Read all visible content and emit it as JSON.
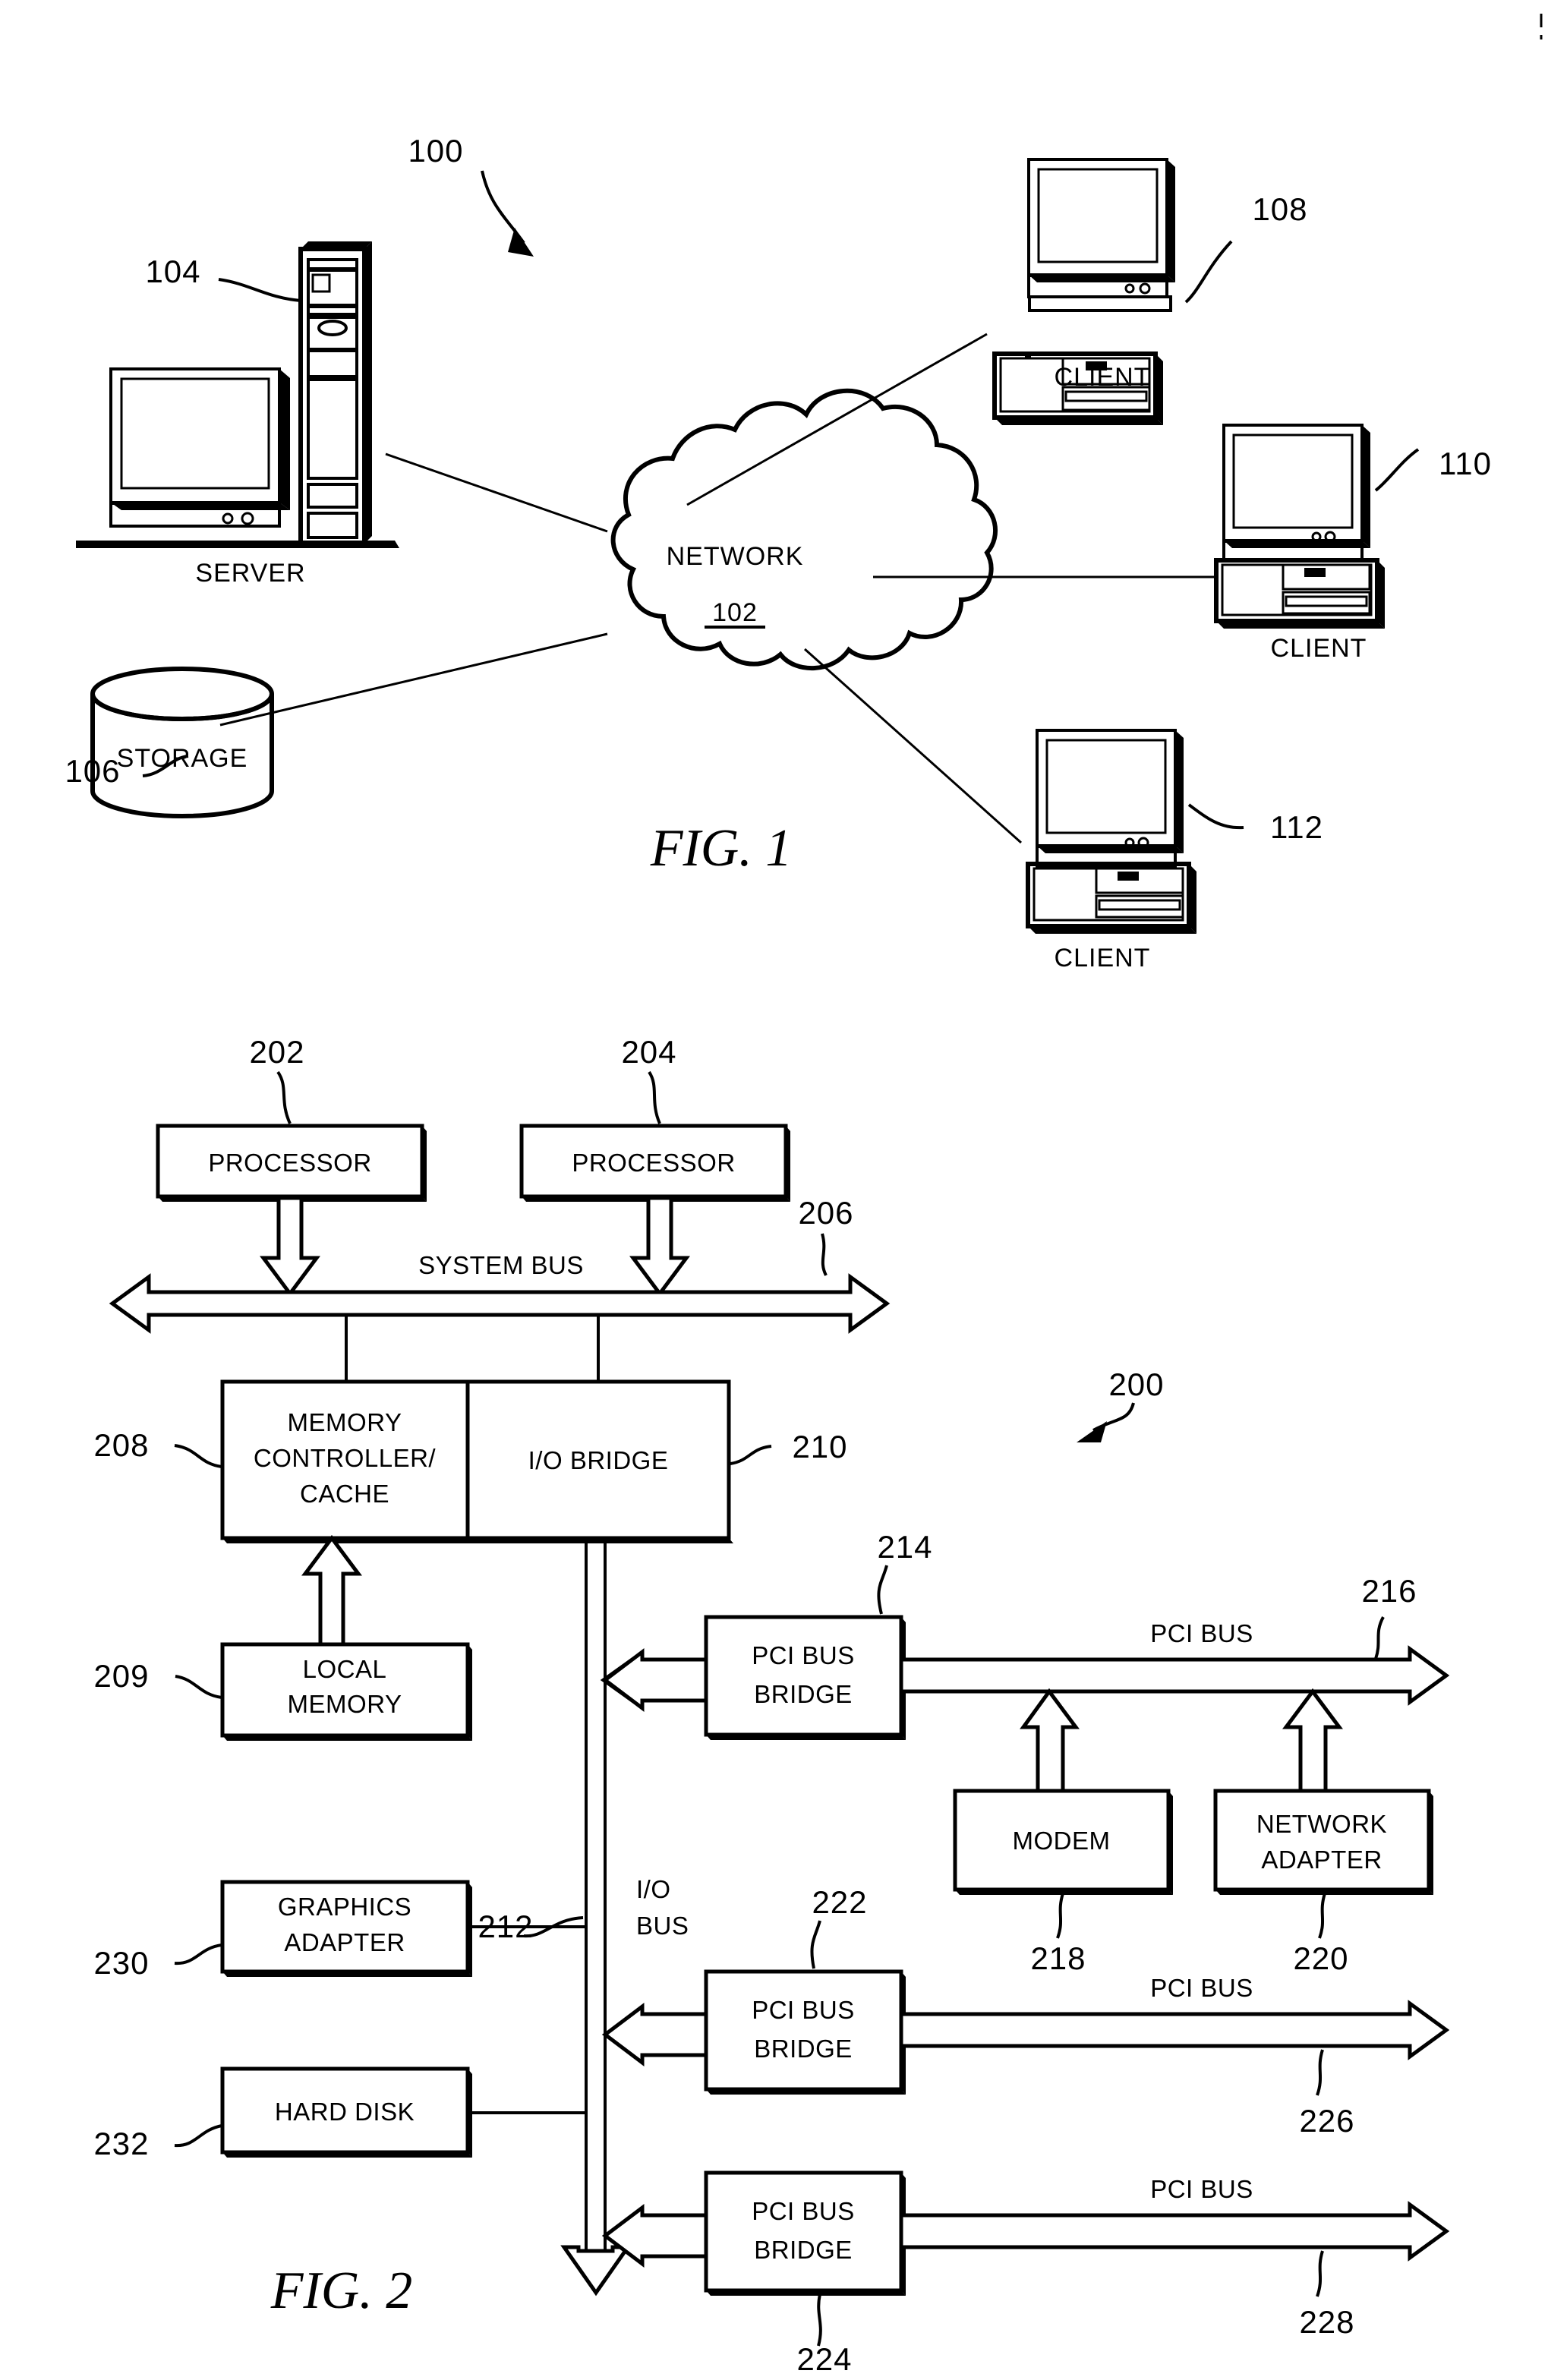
{
  "document": {
    "kind": "patent-drawing-sheet",
    "figures": [
      "FIG.  1",
      "FIG.  2"
    ]
  },
  "figure1": {
    "caption": "FIG.  1",
    "system_ref": "100",
    "network": {
      "label": "NETWORK",
      "ref": "102"
    },
    "server": {
      "label": "SERVER",
      "ref": "104"
    },
    "storage": {
      "label": "STORAGE",
      "ref": "106"
    },
    "clients": [
      {
        "label": "CLIENT",
        "ref": "108"
      },
      {
        "label": "CLIENT",
        "ref": "110"
      },
      {
        "label": "CLIENT",
        "ref": "112"
      }
    ]
  },
  "figure2": {
    "caption": "FIG.  2",
    "system_ref": "200",
    "blocks": [
      {
        "id": "processor1",
        "label": "PROCESSOR",
        "ref": "202"
      },
      {
        "id": "processor2",
        "label": "PROCESSOR",
        "ref": "204"
      },
      {
        "id": "memory_controller",
        "label": "MEMORY CONTROLLER/ CACHE",
        "ref": "208",
        "lines": [
          "MEMORY",
          "CONTROLLER/",
          "CACHE"
        ]
      },
      {
        "id": "io_bridge",
        "label": "I/O BRIDGE",
        "ref": "210"
      },
      {
        "id": "local_memory",
        "label": "LOCAL MEMORY",
        "ref": "209",
        "lines": [
          "LOCAL",
          "MEMORY"
        ]
      },
      {
        "id": "graphics_adapter",
        "label": "GRAPHICS ADAPTER",
        "ref": "230",
        "lines": [
          "GRAPHICS",
          "ADAPTER"
        ]
      },
      {
        "id": "hard_disk",
        "label": "HARD  DISK",
        "ref": "232"
      },
      {
        "id": "pci_bridge_1",
        "label": "PCI BUS BRIDGE",
        "ref": "214",
        "lines": [
          "PCI BUS",
          "BRIDGE"
        ]
      },
      {
        "id": "pci_bridge_2",
        "label": "PCI BUS BRIDGE",
        "ref": "222",
        "lines": [
          "PCI BUS",
          "BRIDGE"
        ]
      },
      {
        "id": "pci_bridge_3",
        "label": "PCI BUS BRIDGE",
        "ref": "224",
        "lines": [
          "PCI BUS",
          "BRIDGE"
        ]
      },
      {
        "id": "modem",
        "label": "MODEM",
        "ref": "218"
      },
      {
        "id": "network_adapter",
        "label": "NETWORK ADAPTER",
        "ref": "220",
        "lines": [
          "NETWORK",
          "ADAPTER"
        ]
      }
    ],
    "buses": [
      {
        "id": "system_bus",
        "label": "SYSTEM BUS",
        "ref": "206"
      },
      {
        "id": "io_bus",
        "label": "I/O BUS",
        "ref": "212",
        "lines": [
          "I/O",
          "BUS"
        ]
      },
      {
        "id": "pci_bus_1",
        "label": "PCI BUS",
        "ref": "216"
      },
      {
        "id": "pci_bus_2",
        "label": "PCI BUS",
        "ref": "226"
      },
      {
        "id": "pci_bus_3",
        "label": "PCI BUS",
        "ref": "228"
      }
    ]
  }
}
